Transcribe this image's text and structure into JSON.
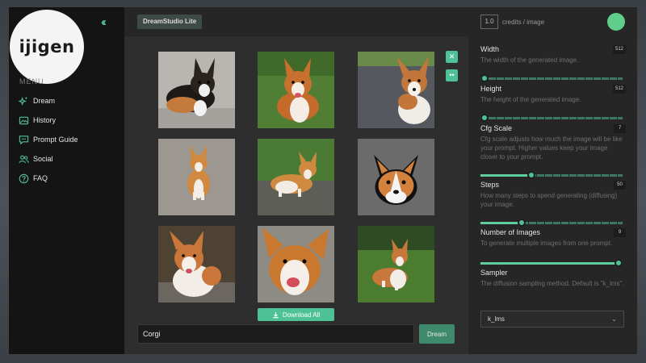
{
  "logo": {
    "text": "ijigen"
  },
  "sidebar": {
    "menu_label": "MENU",
    "items": [
      {
        "label": "Dream",
        "icon": "sparkle-icon"
      },
      {
        "label": "History",
        "icon": "image-history-icon"
      },
      {
        "label": "Prompt Guide",
        "icon": "speech-bubble-icon"
      },
      {
        "label": "Social",
        "icon": "people-icon"
      },
      {
        "label": "FAQ",
        "icon": "question-icon"
      }
    ]
  },
  "header": {
    "collapse_icon": "double-chevron-left-icon",
    "app_name": "DreamStudio Lite",
    "credits_value": "1.0",
    "credits_label": "credits / image"
  },
  "gallery": {
    "subject": "Corgi",
    "download_label": "Download All",
    "close_icon": "close-icon",
    "more_icon": "more-icon"
  },
  "prompt": {
    "value": "Corgi",
    "button_label": "Dream"
  },
  "settings": {
    "width": {
      "label": "Width",
      "value": "512",
      "description": "The width of the generated image.",
      "fraction": 0.0
    },
    "height": {
      "label": "Height",
      "value": "512",
      "description": "The height of the generated image.",
      "fraction": 0.0
    },
    "cfg_scale": {
      "label": "Cfg Scale",
      "value": "7",
      "description": "Cfg scale adjusts how much the image will be like your prompt. Higher values keep your image closer to your prompt.",
      "fraction": 0.35
    },
    "steps": {
      "label": "Steps",
      "value": "50",
      "description": "How many steps to spend generating (diffusing) your image.",
      "fraction": 0.28
    },
    "num_images": {
      "label": "Number of Images",
      "value": "9",
      "description": "To generate multiple images from one prompt.",
      "fraction": 1.0
    },
    "sampler": {
      "label": "Sampler",
      "description": "The diffusion sampling method. Default is \"k_lms\".",
      "selected": "k_lms"
    }
  },
  "colors": {
    "accent": "#4fc196",
    "avatar": "#5fce8a"
  }
}
